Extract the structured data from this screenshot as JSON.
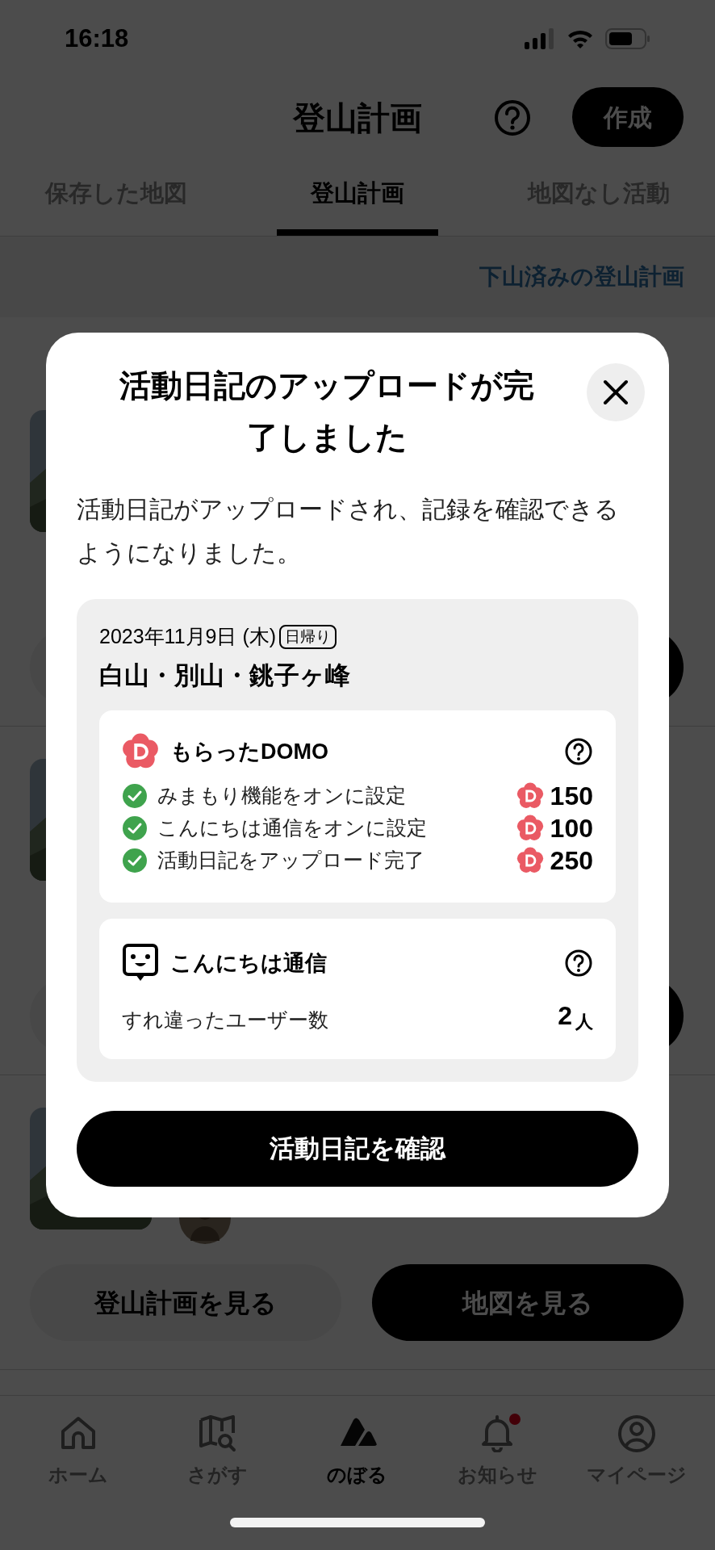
{
  "status_bar": {
    "time": "16:18"
  },
  "header": {
    "title": "登山計画",
    "create_button": "作成"
  },
  "tabs": [
    {
      "label": "保存した地図",
      "selected": false
    },
    {
      "label": "登山計画",
      "selected": true
    },
    {
      "label": "地図なし活動",
      "selected": false
    }
  ],
  "completed_plans_link": "下山済みの登山計画",
  "plan_cards": [
    {
      "kind": "covered"
    },
    {
      "kind": "covered"
    },
    {
      "kind": "full",
      "view_plan_button": "登山計画を見る",
      "view_map_button": "地図を見る"
    }
  ],
  "modal": {
    "title": "活動日記のアップロードが完了しました",
    "message": "活動日記がアップロードされ、記録を確認できるようになりました。",
    "date": "2023年11月9日 (木)",
    "trip_tag": "日帰り",
    "mountains": "白山・別山・銚子ヶ峰",
    "domo": {
      "title": "もらったDOMO",
      "items": [
        {
          "label": "みまもり機能をオンに設定",
          "points": "150",
          "checked": true
        },
        {
          "label": "こんにちは通信をオンに設定",
          "points": "100",
          "checked": true
        },
        {
          "label": "活動日記をアップロード完了",
          "points": "250",
          "checked": true
        }
      ]
    },
    "hello": {
      "title": "こんにちは通信",
      "label": "すれ違ったユーザー数",
      "count": "2",
      "unit": "人"
    },
    "confirm_button": "活動日記を確認"
  },
  "bottom_nav": [
    {
      "label": "ホーム",
      "selected": false,
      "badge": false
    },
    {
      "label": "さがす",
      "selected": false,
      "badge": false
    },
    {
      "label": "のぼる",
      "selected": true,
      "badge": false
    },
    {
      "label": "お知らせ",
      "selected": false,
      "badge": true
    },
    {
      "label": "マイページ",
      "selected": false,
      "badge": false
    }
  ]
}
